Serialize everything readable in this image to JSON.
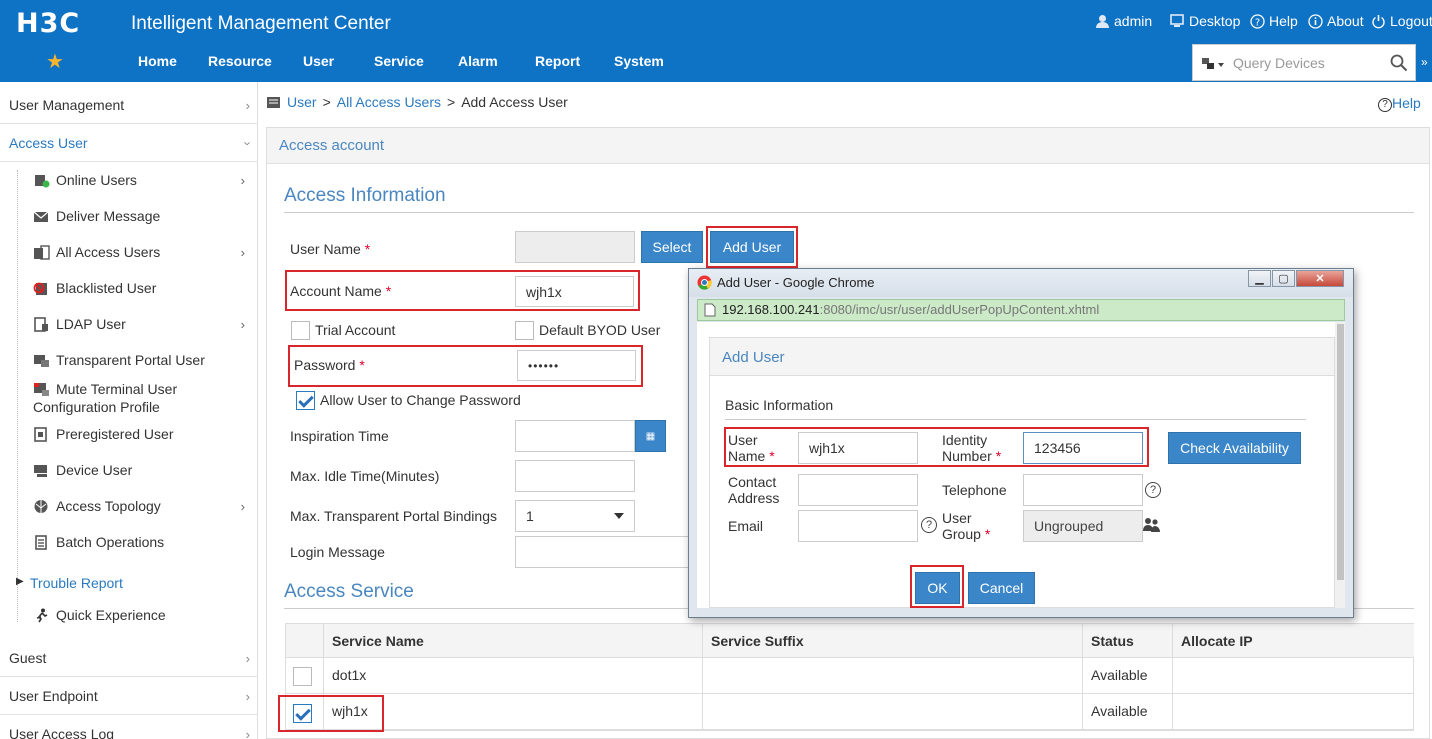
{
  "header": {
    "logo": "H3C",
    "title": "Intelligent Management Center",
    "user": "admin",
    "desktop": "Desktop",
    "help": "Help",
    "about": "About",
    "logout": "Logout",
    "menu": [
      "Home",
      "Resource",
      "User",
      "Service",
      "Alarm",
      "Report",
      "System"
    ],
    "query_placeholder": "Query Devices"
  },
  "sidebar": {
    "sections": [
      "User Management",
      "Access User",
      "Guest",
      "User Endpoint",
      "User Access Log"
    ],
    "items": [
      "Online Users",
      "Deliver Message",
      "All Access Users",
      "Blacklisted User",
      "LDAP User",
      "Transparent Portal User",
      "Mute Terminal User",
      "Configuration Profile",
      "Preregistered User",
      "Device User",
      "Access Topology",
      "Batch Operations",
      "Trouble Report",
      "Quick Experience"
    ]
  },
  "breadcrumb": {
    "root": "User",
    "parent": "All Access Users",
    "current": "Add Access User"
  },
  "help_link": "Help",
  "panel_title": "Access account",
  "access_info": {
    "title": "Access Information",
    "user_name_label": "User Name",
    "select_btn": "Select",
    "add_user_btn": "Add User",
    "account_name_label": "Account Name",
    "account_name_value": "wjh1x",
    "trial_account": "Trial Account",
    "default_byod": "Default BYOD User",
    "password_label": "Password",
    "password_value": "••••••",
    "allow_change": "Allow User to Change Password",
    "inspiration_time": "Inspiration Time",
    "max_idle": "Max. Idle Time(Minutes)",
    "max_portal": "Max. Transparent Portal Bindings",
    "max_portal_value": "1",
    "login_message": "Login Message"
  },
  "access_service": {
    "title": "Access Service",
    "columns": [
      "Service Name",
      "Service Suffix",
      "Status",
      "Allocate IP"
    ],
    "rows": [
      {
        "name": "dot1x",
        "suffix": "",
        "status": "Available",
        "ip": ""
      },
      {
        "name": "wjh1x",
        "suffix": "",
        "status": "Available",
        "ip": ""
      }
    ]
  },
  "popup": {
    "window_title": "Add User - Google Chrome",
    "url_host": "192.168.100.241",
    "url_rest": ":8080/imc/usr/user/addUserPopUpContent.xhtml",
    "title": "Add User",
    "basic_info": "Basic Information",
    "user_name_l1": "User",
    "user_name_l2": "Name",
    "user_name_value": "wjh1x",
    "identity_l1": "Identity",
    "identity_l2": "Number",
    "identity_value": "123456",
    "check_btn": "Check Availability",
    "contact_l1": "Contact",
    "contact_l2": "Address",
    "telephone": "Telephone",
    "email": "Email",
    "group_l1": "User",
    "group_l2": "Group",
    "group_value": "Ungrouped",
    "ok": "OK",
    "cancel": "Cancel"
  },
  "colors": {
    "header": "#0e72c5",
    "accent": "#3a86c8",
    "link": "#2a7ac0",
    "highlight": "#d9262c"
  }
}
